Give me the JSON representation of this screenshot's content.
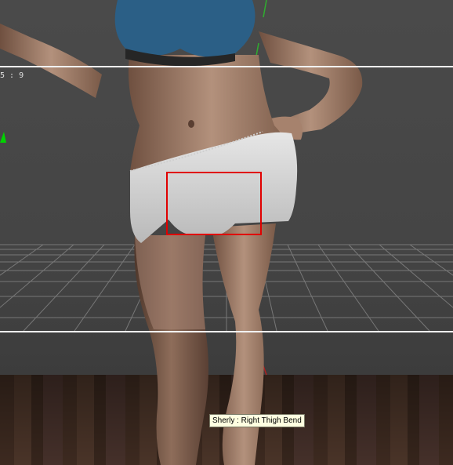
{
  "viewport": {
    "frame_counter": "5 : 9",
    "tooltip": "Sherly : Right Thigh Bend",
    "selected_figure": "Sherly",
    "selected_bone": "Right Thigh Bend",
    "colors": {
      "selection_box": "#e00000",
      "guide_lines": "#f2f2f2",
      "tooltip_bg": "#ffffe1",
      "axis_green": "#00d400"
    }
  }
}
